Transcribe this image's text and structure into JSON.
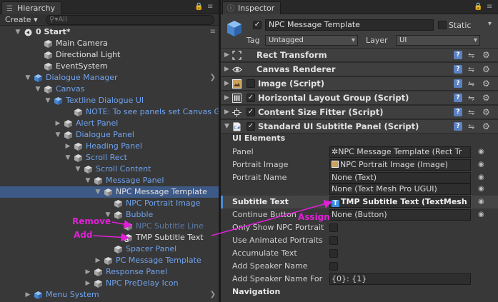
{
  "hierarchy": {
    "tab_title": "Hierarchy",
    "create_label": "Create",
    "search_placeholder": "All",
    "rows": [
      {
        "label": "0 Start*",
        "style": "bold",
        "indent": 0,
        "arrow": "down",
        "icon": "unity-scene-icon",
        "right_arrow": false
      },
      {
        "label": "Main Camera",
        "style": "w",
        "indent": 2,
        "arrow": "",
        "icon": "gameobject-cube-icon",
        "right_arrow": false
      },
      {
        "label": "Directional Light",
        "style": "w",
        "indent": 2,
        "arrow": "",
        "icon": "gameobject-cube-icon",
        "right_arrow": false
      },
      {
        "label": "EventSystem",
        "style": "w",
        "indent": 2,
        "arrow": "",
        "icon": "gameobject-cube-icon",
        "right_arrow": false
      },
      {
        "label": "Dialogue Manager",
        "style": "b",
        "indent": 1,
        "arrow": "down",
        "icon": "prefab-cube-icon",
        "right_arrow": true
      },
      {
        "label": "Canvas",
        "style": "b",
        "indent": 2,
        "arrow": "down",
        "icon": "gameobject-cube-icon",
        "right_arrow": false
      },
      {
        "label": "Textline Dialogue UI",
        "style": "b",
        "indent": 3,
        "arrow": "down",
        "icon": "prefab-cube-icon",
        "right_arrow": false
      },
      {
        "label": "NOTE: To see panels set Canvas G",
        "style": "b",
        "indent": 5,
        "arrow": "",
        "icon": "gameobject-cube-icon",
        "right_arrow": false
      },
      {
        "label": "Alert Panel",
        "style": "b",
        "indent": 4,
        "arrow": "right",
        "icon": "gameobject-cube-icon",
        "right_arrow": false
      },
      {
        "label": "Dialogue Panel",
        "style": "b",
        "indent": 4,
        "arrow": "down",
        "icon": "gameobject-cube-icon",
        "right_arrow": false
      },
      {
        "label": "Heading Panel",
        "style": "b",
        "indent": 5,
        "arrow": "right",
        "icon": "gameobject-cube-icon",
        "right_arrow": false
      },
      {
        "label": "Scroll Rect",
        "style": "b",
        "indent": 5,
        "arrow": "down",
        "icon": "gameobject-cube-icon",
        "right_arrow": false
      },
      {
        "label": "Scroll Content",
        "style": "b",
        "indent": 6,
        "arrow": "down",
        "icon": "gameobject-cube-icon",
        "right_arrow": false
      },
      {
        "label": "Message Panel",
        "style": "b",
        "indent": 7,
        "arrow": "down",
        "icon": "gameobject-cube-icon",
        "right_arrow": false
      },
      {
        "label": "NPC Message Template",
        "style": "w",
        "indent": 8,
        "arrow": "down",
        "icon": "gameobject-cube-icon",
        "right_arrow": false,
        "selected": true
      },
      {
        "label": "NPC Portrait Image",
        "style": "b",
        "indent": 9,
        "arrow": "",
        "icon": "gameobject-cube-icon",
        "right_arrow": false
      },
      {
        "label": "Bubble",
        "style": "b",
        "indent": 9,
        "arrow": "down",
        "icon": "gameobject-cube-icon",
        "right_arrow": false
      },
      {
        "label": "NPC Subtitle Line",
        "style": "d",
        "indent": 10,
        "arrow": "",
        "icon": "gameobject-cube-icon",
        "right_arrow": false
      },
      {
        "label": "TMP Subtitle Text",
        "style": "w",
        "indent": 10,
        "arrow": "",
        "icon": "gameobject-cube-add-icon",
        "right_arrow": false
      },
      {
        "label": "Spacer Panel",
        "style": "b",
        "indent": 9,
        "arrow": "",
        "icon": "gameobject-cube-icon",
        "right_arrow": false
      },
      {
        "label": "PC Message Template",
        "style": "b",
        "indent": 8,
        "arrow": "right",
        "icon": "gameobject-cube-icon",
        "right_arrow": false
      },
      {
        "label": "Response Panel",
        "style": "b",
        "indent": 7,
        "arrow": "right",
        "icon": "gameobject-cube-icon",
        "right_arrow": false
      },
      {
        "label": "NPC PreDelay Icon",
        "style": "b",
        "indent": 7,
        "arrow": "right",
        "icon": "gameobject-cube-icon",
        "right_arrow": false
      },
      {
        "label": "Menu System",
        "style": "b",
        "indent": 1,
        "arrow": "right",
        "icon": "prefab-cube-icon",
        "right_arrow": true
      }
    ]
  },
  "inspector": {
    "tab_title": "Inspector",
    "object_name": "NPC Message Template",
    "static_label": "Static",
    "tag_label": "Tag",
    "tag_value": "Untagged",
    "layer_label": "Layer",
    "layer_value": "UI",
    "components": [
      {
        "title": "Rect Transform",
        "icon": "rect-transform-icon",
        "has_check": false
      },
      {
        "title": "Canvas Renderer",
        "icon": "eye-icon",
        "has_check": false
      },
      {
        "title": "Image (Script)",
        "icon": "image-component-icon",
        "has_check": true,
        "checked": false
      },
      {
        "title": "Horizontal Layout Group (Script)",
        "icon": "layout-group-icon",
        "has_check": true,
        "checked": true
      },
      {
        "title": "Content Size Fitter (Script)",
        "icon": "size-fitter-icon",
        "has_check": true,
        "checked": true
      },
      {
        "title": "Standard UI Subtitle Panel (Script)",
        "icon": "script-file-icon",
        "has_check": true,
        "checked": true
      }
    ],
    "ui_elements_heading": "UI Elements",
    "props": [
      {
        "label": "Panel",
        "value": "✲NPC Message Template (Rect Tr",
        "type": "field"
      },
      {
        "label": "Portrait Image",
        "value": "NPC Portrait Image (Image)",
        "type": "field"
      },
      {
        "label": "Portrait Name",
        "value": "None (Text)",
        "type": "field"
      },
      {
        "label": "",
        "value": "None (Text Mesh Pro UGUI)",
        "type": "field"
      },
      {
        "label": "Subtitle Text",
        "value": "TMP Subtitle Text (TextMesh",
        "type": "field",
        "highlight": true
      },
      {
        "label": "Continue Button",
        "value": "None (Button)",
        "type": "field"
      },
      {
        "label": "Only Show NPC Portrait",
        "value": "",
        "type": "check"
      },
      {
        "label": "Use Animated Portraits",
        "value": "",
        "type": "check"
      },
      {
        "label": "Accumulate Text",
        "value": "",
        "type": "check"
      },
      {
        "label": "Add Speaker Name",
        "value": "",
        "type": "check"
      },
      {
        "label": "Add Speaker Name For",
        "value": "{0}: {1}",
        "type": "field"
      }
    ],
    "navigation_heading": "Navigation"
  },
  "annotations": {
    "remove": "Remove",
    "add": "Add",
    "assign": "Assign"
  },
  "colors": {
    "annotation": "#e020d8",
    "selection": "#3d5986",
    "prefab_blue": "#6fa3ee"
  }
}
